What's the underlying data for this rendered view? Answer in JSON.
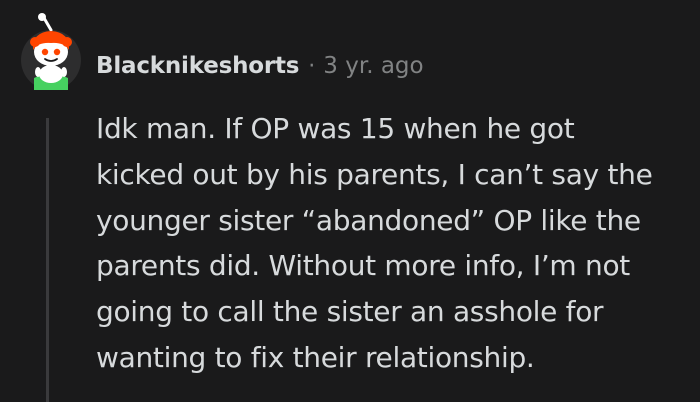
{
  "comment": {
    "author": "Blacknikeshorts",
    "separator": "·",
    "age": "3 yr. ago",
    "avatar_icon": "snoo-avatar-icon",
    "body_lines": [
      "Idk man. If OP was 15 when he got",
      "kicked out by his parents, I can’t say the",
      "younger sister “abandoned” OP like the",
      "parents did. Without more info, I’m not",
      "going to call the sister an asshole for",
      "wanting to fix their relationship."
    ]
  },
  "colors": {
    "background": "#1a1a1b",
    "text": "#d7dadc",
    "muted": "#818384",
    "thread_line": "#3a3a3c",
    "avatar_bg": "#2d2d2e",
    "snoo_hair": "#ff4500",
    "snoo_shirt": "#46d160"
  }
}
